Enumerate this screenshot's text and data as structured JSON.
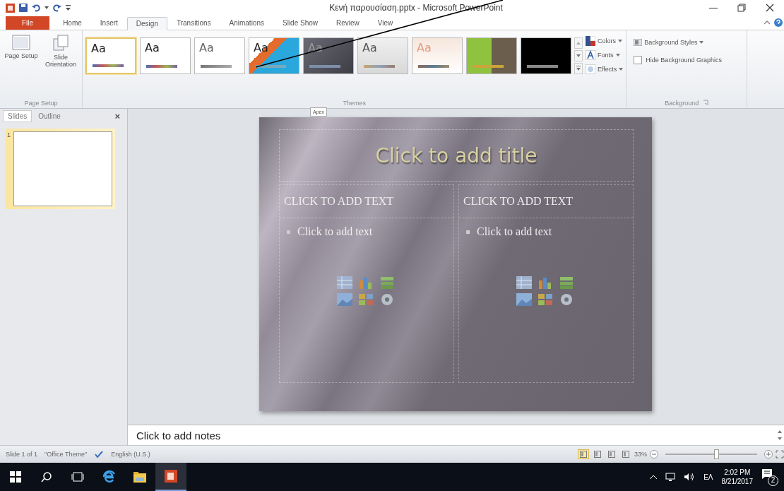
{
  "window": {
    "title": "Κενή παρουσίαση.pptx - Microsoft PowerPoint"
  },
  "tabs": [
    {
      "label": "File",
      "kind": "file",
      "selected": false
    },
    {
      "label": "Home",
      "kind": "plain",
      "selected": false
    },
    {
      "label": "Insert",
      "kind": "plain",
      "selected": false
    },
    {
      "label": "Design",
      "kind": "plain",
      "selected": true
    },
    {
      "label": "Transitions",
      "kind": "plain",
      "selected": false
    },
    {
      "label": "Animations",
      "kind": "plain",
      "selected": false
    },
    {
      "label": "Slide Show",
      "kind": "plain",
      "selected": false
    },
    {
      "label": "Review",
      "kind": "plain",
      "selected": false
    },
    {
      "label": "View",
      "kind": "plain",
      "selected": false
    }
  ],
  "ribbon": {
    "page_setup": {
      "buttons": [
        "Page Setup",
        "Slide Orientation"
      ],
      "label": "Page Setup"
    },
    "themes": {
      "label": "Themes",
      "items": [
        {
          "label": "Aa",
          "kind": "white",
          "selected": true
        },
        {
          "label": "Aa",
          "kind": "white",
          "selected": false
        },
        {
          "label": "Aa",
          "kind": "light",
          "selected": false
        },
        {
          "label": "Aa",
          "kind": "blue",
          "selected": false
        },
        {
          "label": "Aa",
          "kind": "slate",
          "selected": false
        },
        {
          "label": "Aa",
          "kind": "silver",
          "selected": false
        },
        {
          "label": "Aa",
          "kind": "peach",
          "selected": false
        },
        {
          "kind": "green",
          "selected": false
        },
        {
          "kind": "black",
          "selected": false
        }
      ],
      "menus": [
        "Colors",
        "Fonts",
        "Effects"
      ]
    },
    "background": {
      "label": "Background",
      "styles_button": "Background Styles",
      "hide_graphics": {
        "label": "Hide Background Graphics",
        "checked": false
      }
    }
  },
  "tooltip": "Apex",
  "side_pane": {
    "tabs": [
      {
        "label": "Slides",
        "selected": true
      },
      {
        "label": "Outline",
        "selected": false
      }
    ],
    "close": "×",
    "slides": [
      {
        "number": "1",
        "selected": true
      }
    ]
  },
  "slide": {
    "title": "Click to add title",
    "columns": [
      {
        "heading": "CLICK TO ADD TEXT",
        "bullet": "Click to add text"
      },
      {
        "heading": "CLICK TO ADD TEXT",
        "bullet": "Click to add text"
      }
    ]
  },
  "notes": {
    "placeholder": "Click to add notes"
  },
  "status_bar": {
    "slide": "Slide 1 of 1",
    "theme": "\"Office Theme\"",
    "language": "English (U.S.)",
    "views": [
      {
        "selected": true
      },
      {
        "selected": false
      },
      {
        "selected": false
      },
      {
        "selected": false
      }
    ],
    "zoom": "33%",
    "zoom_level": {
      "level": 0.55
    }
  },
  "taskbar": {
    "language": "ΕΛ",
    "time": "2:02 PM",
    "date": "8/21/2017",
    "notifications": "2"
  }
}
